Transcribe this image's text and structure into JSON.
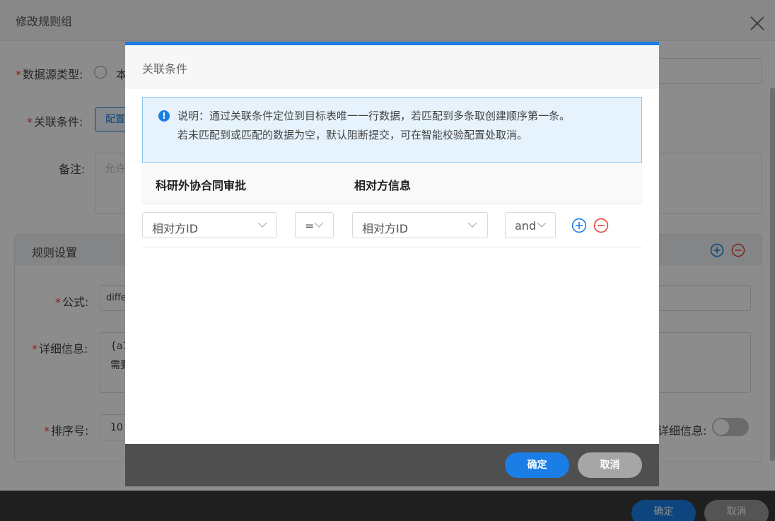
{
  "outer": {
    "title": "修改规则组",
    "required_mark": "*",
    "datasource_label": "数据源类型:",
    "datasource_option_partial": "本",
    "relation_label": "关联条件:",
    "relation_button_partial": "配置",
    "remark_label": "备注:",
    "remark_placeholder_partial": "允许",
    "rule_panel": {
      "title": "规则设置",
      "formula_label": "公式:",
      "formula_value_partial": "diffe",
      "detail_label": "详细信息:",
      "detail_value_line1_partial": "{a1",
      "detail_value_line2_partial": "需要",
      "order_label": "排序号:",
      "order_value_partial": "10",
      "toggle_label_partial": "详细信息:"
    },
    "footer": {
      "ok_label": "确定",
      "cancel_label": "取消"
    }
  },
  "modal": {
    "title": "关联条件",
    "notice": {
      "icon": "!",
      "line1": "说明：通过关联条件定位到目标表唯一一行数据，若匹配到多条取创建顺序第一条。",
      "line2": "若未匹配到或匹配的数据为空，默认阻断提交，可在智能校验配置处取消。"
    },
    "table": {
      "columns": [
        "科研外协合同审批",
        "相对方信息"
      ],
      "rows": [
        {
          "left_field": "相对方ID",
          "operator": "=",
          "right_field": "相对方ID",
          "logic": "and"
        }
      ]
    },
    "footer": {
      "ok_label": "确定",
      "cancel_label": "取消"
    }
  },
  "colors": {
    "primary": "#1a7ee6",
    "danger": "#e8463a",
    "notice_bg": "#e6f3fd",
    "notice_border": "#8cc4ee"
  }
}
